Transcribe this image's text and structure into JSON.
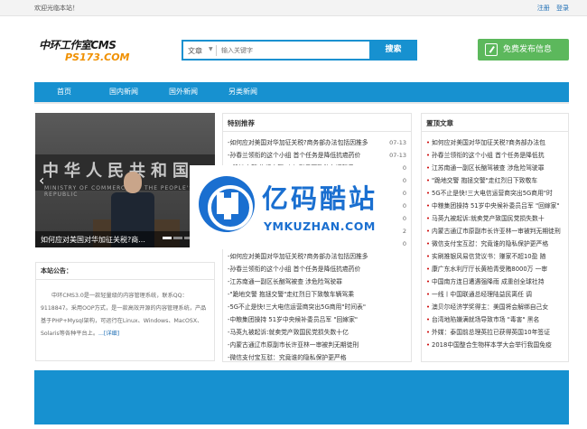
{
  "topbar": {
    "welcome": "欢迎光临本站！",
    "register": "注册",
    "login": "登录"
  },
  "logo": {
    "line1": "中环工作室CMS",
    "line2": "PS173.COM"
  },
  "search": {
    "category": "文章",
    "placeholder": "输入关键字",
    "button": "搜索"
  },
  "publish": {
    "label": "免费发布信息",
    "icon": "check-square-icon"
  },
  "nav": {
    "items": [
      "首页",
      "国内新闻",
      "国外新闻",
      "另类新闻"
    ]
  },
  "slider": {
    "wall_text": "中华人民共和国",
    "wall_sub": "MINISTRY OF COMMERCE OF THE PEOPLE'S REPUBLIC",
    "caption": "如何应对美国对华加征关税?商..."
  },
  "notice": {
    "title": "本站公告：",
    "body": "中环CMS3.0是一款轻量级的内容管理系统，联系QQ：9118847。采用OOP方式，是一款高效开源的内容管理系统，产品基于PHP+Mysql架构，可运行在Linux、Windows、MacOSX、Solaris等各种平台上。",
    "more": "...[详细]"
  },
  "featured": {
    "title": "特别推荐",
    "items": [
      {
        "t": "-如何应对美国对华加征关税?商务部办法包括因推多",
        "d": "07-13"
      },
      {
        "t": "-孙春兰领衔的这个小组 首个任务是降低抗癌药价",
        "d": "07-13"
      },
      {
        "t": "-\"跪地交警 抱拯交警\"走红烈日下致敬车辆驾乘",
        "d": "07-10"
      },
      {
        "t": "-",
        "d": "-10"
      },
      {
        "t": "-",
        "d": "-10"
      },
      {
        "t": "-",
        "d": "-10"
      },
      {
        "t": "-",
        "d": "-10"
      },
      {
        "t": "-",
        "d": "-02"
      },
      {
        "t": "-",
        "d": "-10"
      },
      {
        "t": "-如何应对美国对华加征关税?商务部办法包括因推多",
        "d": ""
      },
      {
        "t": "-孙春兰领衔的这个小组 首个任务是降低抗癌药价",
        "d": ""
      },
      {
        "t": "-江苏南通一副区长酗驾被查 涉危险驾驶罪",
        "d": ""
      },
      {
        "t": "-\"跪地交警 抱拯交警\"走红烈日下致敬车辆驾乘",
        "d": ""
      },
      {
        "t": "-5G不止是快!三大电信运营商突出5G商用\"时间表\"",
        "d": ""
      },
      {
        "t": "-中粮集团操持 51岁中央候补委员吕军 \"回嫁家\"",
        "d": ""
      },
      {
        "t": "-马英九被起诉:就卖党产致国民党损失数十亿",
        "d": ""
      },
      {
        "t": "-内蒙古通辽市原副市长许亚林一审被判无期徒刑",
        "d": ""
      },
      {
        "t": "-微信支付宝互怼：究竟谁的隐私保护更严格",
        "d": ""
      }
    ]
  },
  "top_articles": {
    "title": "置顶文章",
    "items": [
      "如何应对美国对华加征关税?商务部办法包",
      "孙春兰领衔的这个小组 首个任务是降低抗",
      "江苏南通一副区长酗驾被查 涉危险驾驶罪",
      "\"跪地交警 抱拯交警\"走红烈日下致敬车",
      "5G不止是快!三大电信运营商突出5G商用\"时",
      "中粮集团操持 51岁中央候补委员吕军 \"回嫁家\"",
      "马英九被起诉:就卖党产致国民党损失数十",
      "内蒙古通辽市原副市长许亚林一审被判无期徒刑",
      "微信支付宝互怼：究竟谁的隐私保护更严格",
      "实刷推银风易信贷议书：赚家不超10盈 随",
      "康广东水利厅厅长黄柏青受贿8000万 一审",
      "中国南方连日遭遇强降雨 成重创全球社持",
      "一线丨中国联通总经理陆益民离任 调",
      "澳贝尔经济学奖得主：美国将会解绑自己女",
      "台湾地陷嫌满就场导致市场 \"毒害\" 黑名",
      "外媒：泰国前总理英拉已获得英国10年签证",
      "2018中国整合生物样本学大会举行我国免疫"
    ]
  },
  "watermark": {
    "cn": "亿码酷站",
    "en": "YMKUZHAN.COM"
  },
  "colors": {
    "primary": "#1791d0",
    "publish": "#5cb85c",
    "logo_accent": "#f09000",
    "watermark": "#1a6fd0"
  }
}
